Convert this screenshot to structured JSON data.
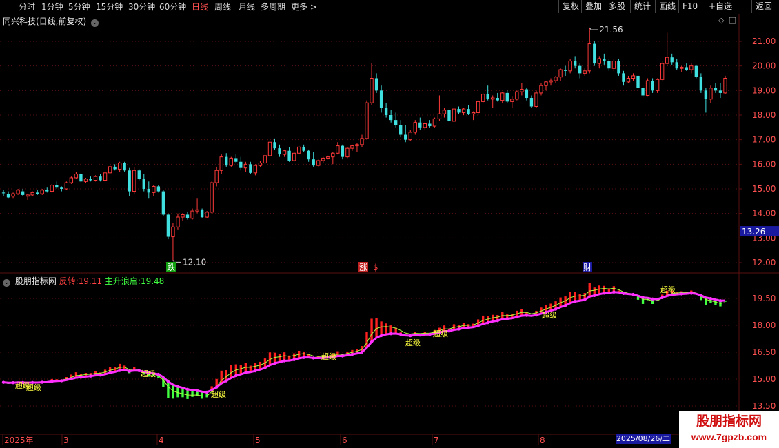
{
  "toolbar": {
    "periods": [
      "分时",
      "1分钟",
      "5分钟",
      "15分钟",
      "30分钟",
      "60分钟",
      "日线",
      "周线",
      "月线",
      "多周期",
      "更多 >"
    ],
    "active_period": "日线",
    "buttons": [
      "复权",
      "叠加",
      "多股",
      "统计",
      "画线",
      "F10",
      "+自选",
      "返回"
    ]
  },
  "stock": {
    "title": "同兴科技(日线,前复权)",
    "high_label": "21.56",
    "low_label": "12.10",
    "current_price": "13.26",
    "price_axis": [
      "21.00",
      "20.00",
      "19.00",
      "18.00",
      "17.00",
      "16.00",
      "15.00",
      "14.00",
      "13.00",
      "12.00"
    ],
    "markers": [
      "跌",
      "涨",
      "$",
      "财"
    ]
  },
  "indicator": {
    "name": "股朋指标网",
    "label1": "反转:",
    "value1": "19.11",
    "label2": "主升浪启:",
    "value2": "19.48",
    "axis": [
      "19.50",
      "18.00",
      "16.50",
      "15.00",
      "13.50"
    ],
    "super_label": "超级"
  },
  "time_axis": {
    "labels": [
      "2025年",
      "3",
      "4",
      "5",
      "6",
      "7",
      "8"
    ],
    "current_date": "2025/08/26/二"
  },
  "watermark": {
    "line1": "股朋指标网",
    "line2": "www.7gpzb.com"
  },
  "colors": {
    "up": "#ff3a3a",
    "down": "#40e0e0",
    "ind_up": "#ff2020",
    "ind_down": "#40ff40",
    "ma_line": "#ff30ff",
    "grid": "#5a1010"
  },
  "chart_data": {
    "type": "candlestick",
    "ylim": [
      11.7,
      21.9
    ],
    "candles": [
      [
        14.85,
        14.95,
        14.7,
        14.82
      ],
      [
        14.8,
        14.9,
        14.6,
        14.65
      ],
      [
        14.7,
        14.85,
        14.6,
        14.8
      ],
      [
        14.8,
        15.0,
        14.75,
        14.95
      ],
      [
        14.9,
        15.0,
        14.7,
        14.75
      ],
      [
        14.7,
        14.8,
        14.55,
        14.75
      ],
      [
        14.75,
        14.9,
        14.7,
        14.85
      ],
      [
        14.85,
        14.95,
        14.75,
        14.8
      ],
      [
        14.8,
        15.0,
        14.75,
        14.95
      ],
      [
        14.95,
        15.05,
        14.85,
        14.9
      ],
      [
        14.9,
        15.2,
        14.85,
        15.15
      ],
      [
        15.15,
        15.3,
        15.0,
        15.05
      ],
      [
        15.05,
        15.1,
        14.9,
        15.0
      ],
      [
        15.0,
        15.3,
        14.95,
        15.25
      ],
      [
        15.25,
        15.5,
        15.2,
        15.45
      ],
      [
        15.45,
        15.7,
        15.4,
        15.6
      ],
      [
        15.6,
        15.65,
        15.25,
        15.3
      ],
      [
        15.3,
        15.45,
        15.25,
        15.4
      ],
      [
        15.4,
        15.5,
        15.3,
        15.35
      ],
      [
        15.35,
        15.55,
        15.3,
        15.5
      ],
      [
        15.5,
        15.6,
        15.3,
        15.35
      ],
      [
        15.35,
        15.7,
        15.3,
        15.65
      ],
      [
        15.65,
        15.95,
        15.6,
        15.9
      ],
      [
        15.9,
        16.0,
        15.75,
        15.8
      ],
      [
        15.8,
        16.1,
        15.7,
        16.05
      ],
      [
        16.05,
        16.1,
        15.7,
        15.75
      ],
      [
        15.75,
        15.85,
        14.7,
        14.9
      ],
      [
        14.9,
        15.9,
        14.8,
        15.75
      ],
      [
        15.75,
        15.8,
        15.35,
        15.4
      ],
      [
        15.4,
        15.6,
        14.9,
        15.0
      ],
      [
        15.0,
        15.3,
        14.6,
        14.85
      ],
      [
        14.85,
        15.15,
        14.7,
        15.1
      ],
      [
        15.1,
        15.15,
        14.85,
        14.9
      ],
      [
        14.9,
        14.95,
        13.9,
        13.95
      ],
      [
        13.95,
        14.0,
        12.95,
        13.05
      ],
      [
        13.05,
        13.6,
        12.1,
        13.45
      ],
      [
        13.45,
        14.0,
        13.35,
        13.85
      ],
      [
        13.85,
        14.0,
        13.7,
        13.95
      ],
      [
        13.95,
        14.05,
        13.75,
        13.8
      ],
      [
        13.8,
        14.2,
        13.75,
        14.1
      ],
      [
        14.1,
        14.6,
        14.0,
        14.15
      ],
      [
        14.15,
        14.2,
        13.8,
        13.85
      ],
      [
        13.85,
        14.1,
        13.8,
        14.05
      ],
      [
        14.05,
        15.3,
        14.0,
        15.25
      ],
      [
        15.25,
        15.9,
        15.1,
        15.75
      ],
      [
        15.75,
        16.4,
        15.6,
        16.3
      ],
      [
        16.3,
        16.45,
        15.9,
        15.95
      ],
      [
        15.95,
        16.3,
        15.9,
        16.25
      ],
      [
        16.25,
        16.4,
        16.05,
        16.1
      ],
      [
        16.1,
        16.3,
        15.75,
        15.85
      ],
      [
        15.85,
        16.1,
        15.7,
        16.0
      ],
      [
        16.0,
        16.1,
        15.6,
        15.65
      ],
      [
        15.65,
        16.0,
        15.55,
        15.95
      ],
      [
        15.95,
        16.15,
        15.9,
        16.05
      ],
      [
        16.05,
        16.4,
        16.0,
        16.35
      ],
      [
        16.35,
        17.0,
        16.3,
        16.9
      ],
      [
        16.9,
        17.05,
        16.6,
        16.65
      ],
      [
        16.65,
        16.8,
        16.3,
        16.4
      ],
      [
        16.4,
        16.6,
        16.3,
        16.55
      ],
      [
        16.55,
        16.7,
        16.1,
        16.15
      ],
      [
        16.15,
        16.5,
        16.1,
        16.45
      ],
      [
        16.45,
        16.75,
        16.4,
        16.7
      ],
      [
        16.7,
        16.8,
        16.5,
        16.55
      ],
      [
        16.55,
        16.6,
        16.1,
        16.2
      ],
      [
        16.2,
        16.5,
        15.9,
        15.95
      ],
      [
        15.95,
        16.2,
        15.9,
        16.15
      ],
      [
        16.15,
        16.3,
        16.05,
        16.25
      ],
      [
        16.25,
        16.35,
        16.2,
        16.3
      ],
      [
        16.3,
        16.5,
        16.0,
        16.45
      ],
      [
        16.45,
        16.9,
        16.4,
        16.75
      ],
      [
        16.75,
        16.8,
        16.2,
        16.3
      ],
      [
        16.3,
        16.7,
        16.25,
        16.65
      ],
      [
        16.65,
        16.8,
        16.55,
        16.75
      ],
      [
        16.75,
        16.85,
        16.5,
        16.8
      ],
      [
        16.8,
        17.2,
        16.7,
        17.05
      ],
      [
        17.05,
        18.6,
        17.0,
        18.5
      ],
      [
        18.5,
        20.1,
        18.4,
        19.5
      ],
      [
        19.5,
        19.7,
        18.9,
        19.0
      ],
      [
        19.0,
        19.2,
        18.1,
        18.3
      ],
      [
        18.3,
        18.5,
        17.9,
        18.0
      ],
      [
        18.0,
        18.2,
        17.7,
        17.8
      ],
      [
        17.8,
        18.1,
        17.5,
        17.6
      ],
      [
        17.6,
        17.8,
        17.1,
        17.2
      ],
      [
        17.2,
        17.6,
        16.9,
        17.0
      ],
      [
        17.0,
        17.4,
        16.95,
        17.3
      ],
      [
        17.3,
        17.8,
        17.2,
        17.7
      ],
      [
        17.7,
        17.9,
        17.4,
        17.5
      ],
      [
        17.5,
        17.7,
        17.4,
        17.65
      ],
      [
        17.65,
        17.8,
        17.5,
        17.55
      ],
      [
        17.55,
        17.9,
        17.5,
        17.85
      ],
      [
        17.85,
        18.8,
        17.75,
        18.05
      ],
      [
        18.05,
        18.3,
        17.9,
        18.2
      ],
      [
        18.2,
        18.3,
        17.7,
        17.75
      ],
      [
        17.75,
        18.3,
        17.7,
        18.25
      ],
      [
        18.25,
        18.35,
        18.05,
        18.1
      ],
      [
        18.1,
        18.3,
        18.0,
        18.25
      ],
      [
        18.25,
        18.4,
        18.0,
        18.05
      ],
      [
        18.05,
        18.15,
        17.8,
        18.1
      ],
      [
        18.1,
        18.6,
        18.0,
        18.55
      ],
      [
        18.55,
        18.9,
        18.5,
        18.85
      ],
      [
        18.85,
        19.2,
        18.6,
        18.65
      ],
      [
        18.65,
        18.8,
        18.3,
        18.7
      ],
      [
        18.7,
        18.9,
        18.55,
        18.6
      ],
      [
        18.6,
        18.95,
        18.5,
        18.9
      ],
      [
        18.9,
        19.0,
        18.5,
        18.55
      ],
      [
        18.55,
        18.75,
        18.3,
        18.65
      ],
      [
        18.65,
        19.0,
        18.6,
        18.95
      ],
      [
        18.95,
        19.3,
        18.8,
        19.05
      ],
      [
        19.05,
        19.1,
        18.6,
        18.7
      ],
      [
        18.7,
        18.8,
        18.3,
        18.35
      ],
      [
        18.35,
        19.0,
        18.3,
        18.9
      ],
      [
        18.9,
        19.3,
        18.8,
        19.2
      ],
      [
        19.2,
        19.4,
        19.0,
        19.35
      ],
      [
        19.35,
        19.5,
        19.2,
        19.4
      ],
      [
        19.4,
        19.6,
        19.3,
        19.55
      ],
      [
        19.55,
        19.9,
        19.4,
        19.85
      ],
      [
        19.85,
        20.0,
        19.6,
        19.8
      ],
      [
        19.8,
        20.3,
        19.7,
        20.2
      ],
      [
        20.2,
        20.4,
        19.9,
        20.0
      ],
      [
        20.0,
        20.1,
        19.5,
        19.7
      ],
      [
        19.7,
        19.9,
        19.6,
        19.8
      ],
      [
        19.8,
        21.56,
        19.7,
        20.9
      ],
      [
        20.9,
        21.0,
        20.0,
        20.1
      ],
      [
        20.1,
        20.4,
        19.9,
        20.3
      ],
      [
        20.3,
        20.5,
        20.05,
        20.2
      ],
      [
        20.2,
        20.3,
        19.8,
        19.9
      ],
      [
        19.9,
        20.3,
        19.8,
        20.2
      ],
      [
        20.2,
        20.3,
        19.6,
        19.7
      ],
      [
        19.7,
        19.8,
        19.2,
        19.35
      ],
      [
        19.35,
        19.6,
        19.3,
        19.5
      ],
      [
        19.5,
        19.7,
        19.4,
        19.6
      ],
      [
        19.6,
        19.7,
        19.0,
        19.1
      ],
      [
        19.1,
        19.2,
        18.7,
        18.8
      ],
      [
        18.8,
        19.5,
        18.75,
        19.4
      ],
      [
        19.4,
        19.5,
        18.9,
        19.0
      ],
      [
        19.0,
        19.5,
        18.9,
        19.45
      ],
      [
        19.45,
        20.2,
        19.4,
        20.1
      ],
      [
        20.1,
        21.35,
        20.0,
        20.35
      ],
      [
        20.35,
        20.5,
        20.05,
        20.15
      ],
      [
        20.15,
        20.3,
        19.85,
        19.9
      ],
      [
        19.9,
        20.0,
        19.75,
        19.95
      ],
      [
        19.95,
        20.1,
        19.8,
        19.85
      ],
      [
        19.85,
        20.1,
        19.7,
        20.0
      ],
      [
        20.0,
        20.05,
        19.5,
        19.55
      ],
      [
        19.55,
        19.7,
        18.9,
        19.0
      ],
      [
        19.0,
        19.1,
        18.1,
        18.65
      ],
      [
        18.65,
        19.2,
        18.5,
        19.1
      ],
      [
        19.1,
        19.3,
        18.9,
        19.0
      ],
      [
        19.0,
        19.3,
        18.7,
        18.9
      ],
      [
        18.9,
        19.6,
        18.85,
        19.5
      ]
    ]
  }
}
